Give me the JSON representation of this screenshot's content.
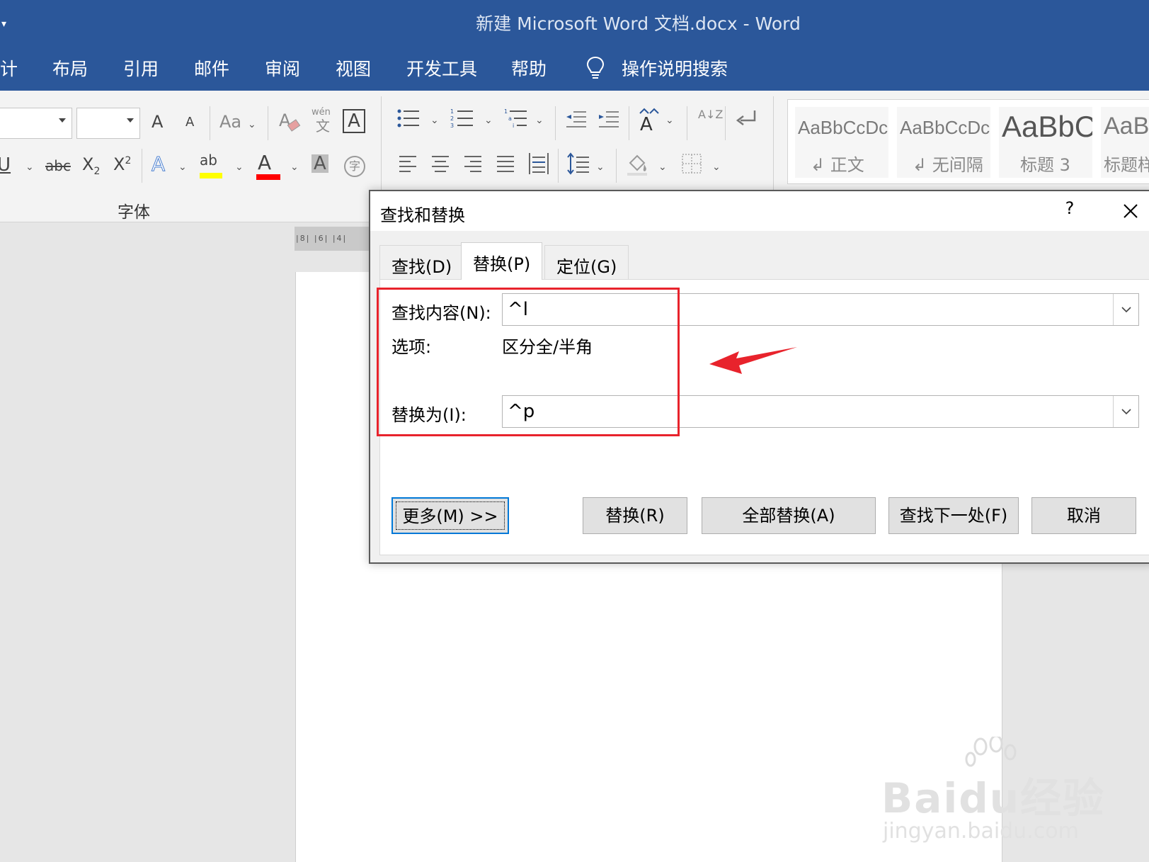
{
  "window": {
    "title": "新建 Microsoft Word 文档.docx  -  Word"
  },
  "menu": {
    "items": [
      "计",
      "布局",
      "引用",
      "邮件",
      "审阅",
      "视图",
      "开发工具",
      "帮助"
    ],
    "tell_me": "操作说明搜索"
  },
  "ribbon": {
    "font": {
      "grow": "A",
      "shrink": "A",
      "change_case": "Aa",
      "phonetic": "wén",
      "phonetic_char": "文",
      "char_border": "A",
      "underline": "U",
      "strike": "abc",
      "sub": "X",
      "sub_mark": "2",
      "sup": "X",
      "sup_mark": "2",
      "text_effect": "A",
      "highlight": "ab",
      "font_color": "A",
      "char_shading": "A",
      "enclose": "字",
      "group_label": "字体"
    },
    "styles": [
      {
        "sample": "AaBbCcDc",
        "name": "↲ 正文"
      },
      {
        "sample": "AaBbCcDc",
        "name": "↲ 无间隔"
      },
      {
        "sample": "AaBbC",
        "name": "标题 3"
      },
      {
        "sample": "AaB",
        "name": "标题样"
      }
    ],
    "sort_icon_text": "A↓Z"
  },
  "ruler": {
    "text": "|8| |6| |4|"
  },
  "dialog": {
    "title": "查找和替换",
    "help": "?",
    "tabs": [
      {
        "label": "查找(D)",
        "active": false
      },
      {
        "label": "替换(P)",
        "active": true
      },
      {
        "label": "定位(G)",
        "active": false
      }
    ],
    "find_label": "查找内容(N):",
    "find_value": "^l",
    "options_label": "选项:",
    "options_value": "区分全/半角",
    "replace_label": "替换为(I):",
    "replace_value": "^p",
    "buttons": {
      "more": "更多(M) >>",
      "replace": "替换(R)",
      "replace_all": "全部替换(A)",
      "find_next": "查找下一处(F)",
      "cancel": "取消"
    }
  },
  "annotation": {
    "box_color": "#e8232c",
    "arrow_color": "#e8232c"
  },
  "watermark": {
    "main": "Baidu经验",
    "sub": "jingyan.baidu.com"
  },
  "colors": {
    "word_blue": "#2b579a",
    "focus_blue": "#0078d7",
    "highlight_yellow": "#ffff00",
    "font_red": "#ff0000"
  }
}
